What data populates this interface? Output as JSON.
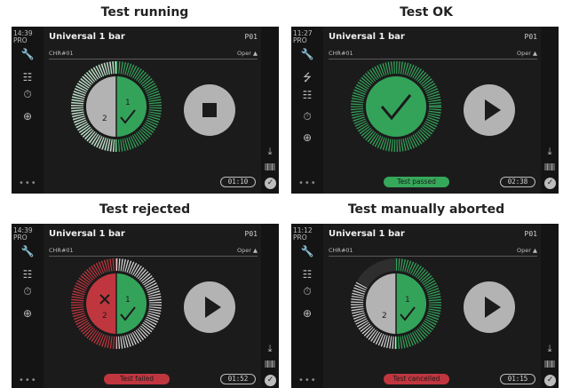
{
  "icons": {
    "menu": [
      "wrench-icon",
      "network-icon",
      "grid-icon",
      "timer-icon",
      "zoom-icon"
    ]
  },
  "colors": {
    "green": "#34a35a",
    "red": "#c0363f",
    "grey": "#b3b3b3",
    "statusOk": "#36a85a",
    "statusFail": "#c0363f"
  },
  "panels": [
    {
      "caption": "Test running",
      "clock": "14:39",
      "mode": "PRO",
      "title": "Universal 1 bar",
      "program": "P01",
      "serial": "CHR#01",
      "operator": "Oper",
      "timer": "01:10",
      "status": "",
      "step1": "1",
      "step2": "2",
      "state": "running"
    },
    {
      "caption": "Test OK",
      "clock": "11:27",
      "mode": "PRO",
      "title": "Universal 1 bar",
      "program": "P01",
      "serial": "CHR#01",
      "operator": "Oper",
      "timer": "02:38",
      "status": "Test passed",
      "step1": "",
      "step2": "",
      "state": "ok"
    },
    {
      "caption": "Test rejected",
      "clock": "14:39",
      "mode": "PRO",
      "title": "Universal 1 bar",
      "program": "P01",
      "serial": "CHR#01",
      "operator": "Oper",
      "timer": "01:52",
      "status": "Test failed",
      "step1": "1",
      "step2": "2",
      "state": "rejected"
    },
    {
      "caption": "Test manually aborted",
      "clock": "11:12",
      "mode": "PRO",
      "title": "Universal 1 bar",
      "program": "P01",
      "serial": "CHR#01",
      "operator": "Oper",
      "timer": "01:15",
      "status": "Test cancelled",
      "step1": "1",
      "step2": "2",
      "state": "aborted"
    }
  ]
}
